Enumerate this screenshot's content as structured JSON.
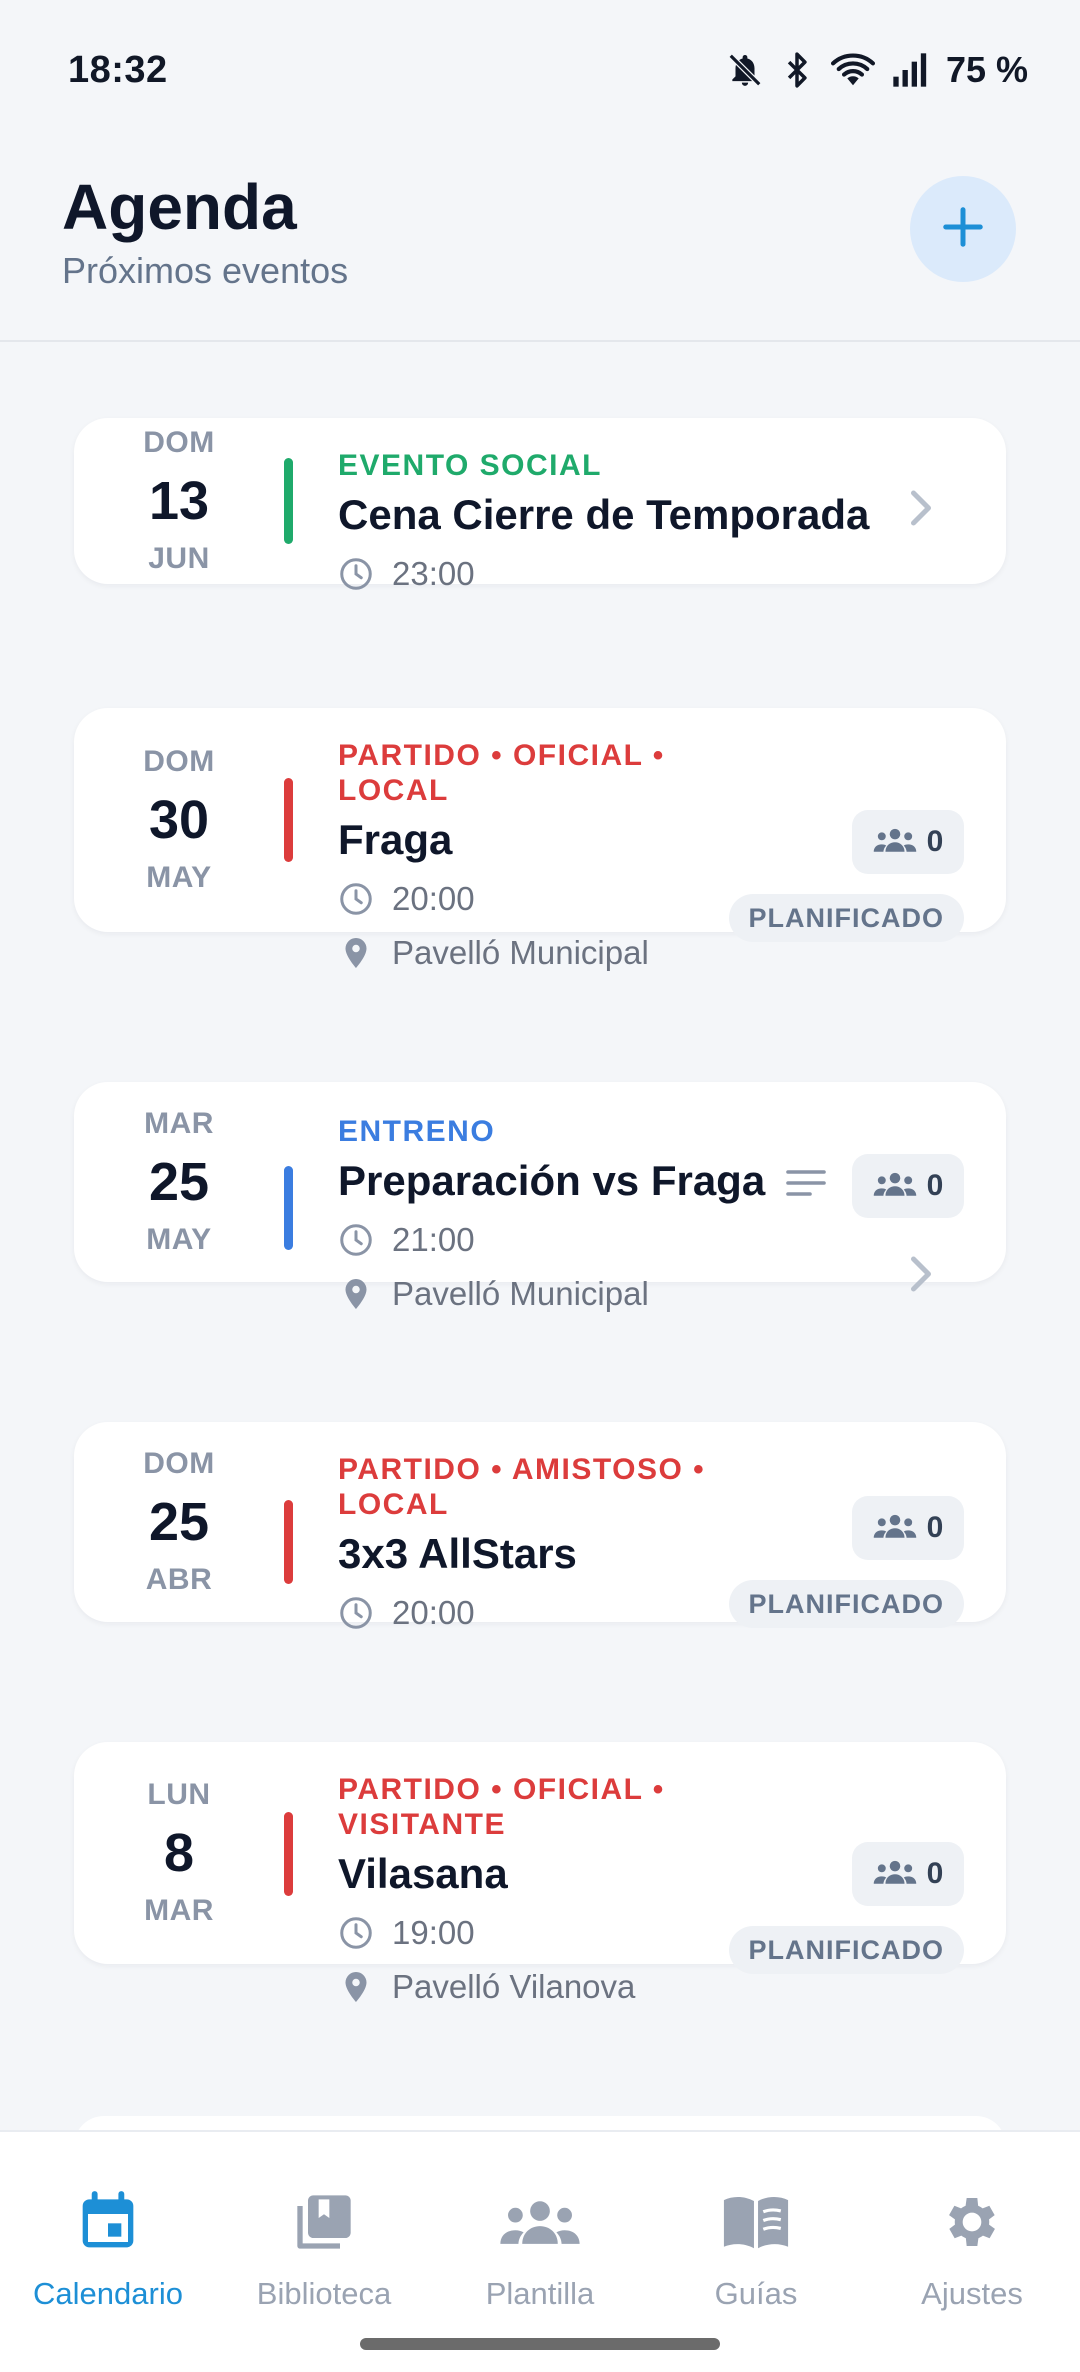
{
  "status_bar": {
    "time": "18:32",
    "battery": "75 %",
    "icons": [
      "bell-off-icon",
      "bluetooth-icon",
      "wifi-icon",
      "signal-icon"
    ]
  },
  "header": {
    "title": "Agenda",
    "subtitle": "Próximos eventos",
    "add_icon": "plus-icon"
  },
  "colors": {
    "social": "#1faa6b",
    "match": "#dc3c3c",
    "training": "#3b7de0",
    "accent": "#1d8fd6"
  },
  "events": [
    {
      "dow": "DOM",
      "day": "13",
      "month": "JUN",
      "type": "EVENTO SOCIAL",
      "type_color": "social",
      "name": "Cena Cierre de Temporada",
      "time": "23:00"
    },
    {
      "dow": "DOM",
      "day": "30",
      "month": "MAY",
      "type_line1": "PARTIDO • OFICIAL •",
      "type_line2": "LOCAL",
      "type_color": "match",
      "name": "Fraga",
      "time": "20:00",
      "location": "Pavelló Municipal",
      "attendees": "0",
      "status": "PLANIFICADO"
    },
    {
      "dow": "MAR",
      "day": "25",
      "month": "MAY",
      "type": "ENTRENO",
      "type_color": "training",
      "name": "Preparación vs Fraga",
      "time": "21:00",
      "location": "Pavelló Municipal",
      "attendees": "0"
    },
    {
      "dow": "DOM",
      "day": "25",
      "month": "ABR",
      "type_line1": "PARTIDO • AMISTOSO •",
      "type_line2": "LOCAL",
      "type_color": "match",
      "name": "3x3 AllStars",
      "time": "20:00",
      "attendees": "0",
      "status": "PLANIFICADO"
    },
    {
      "dow": "LUN",
      "day": "8",
      "month": "MAR",
      "type_line1": "PARTIDO • OFICIAL •",
      "type_line2": "VISITANTE",
      "type_color": "match",
      "name": "Vilasana",
      "time": "19:00",
      "location": "Pavelló Vilanova",
      "attendees": "0",
      "status": "PLANIFICADO"
    }
  ],
  "bottom_nav": {
    "items": [
      {
        "label": "Calendario",
        "icon": "calendar-icon",
        "active": true
      },
      {
        "label": "Biblioteca",
        "icon": "library-icon",
        "active": false
      },
      {
        "label": "Plantilla",
        "icon": "team-icon",
        "active": false
      },
      {
        "label": "Guías",
        "icon": "book-icon",
        "active": false
      },
      {
        "label": "Ajustes",
        "icon": "gear-icon",
        "active": false
      }
    ]
  }
}
